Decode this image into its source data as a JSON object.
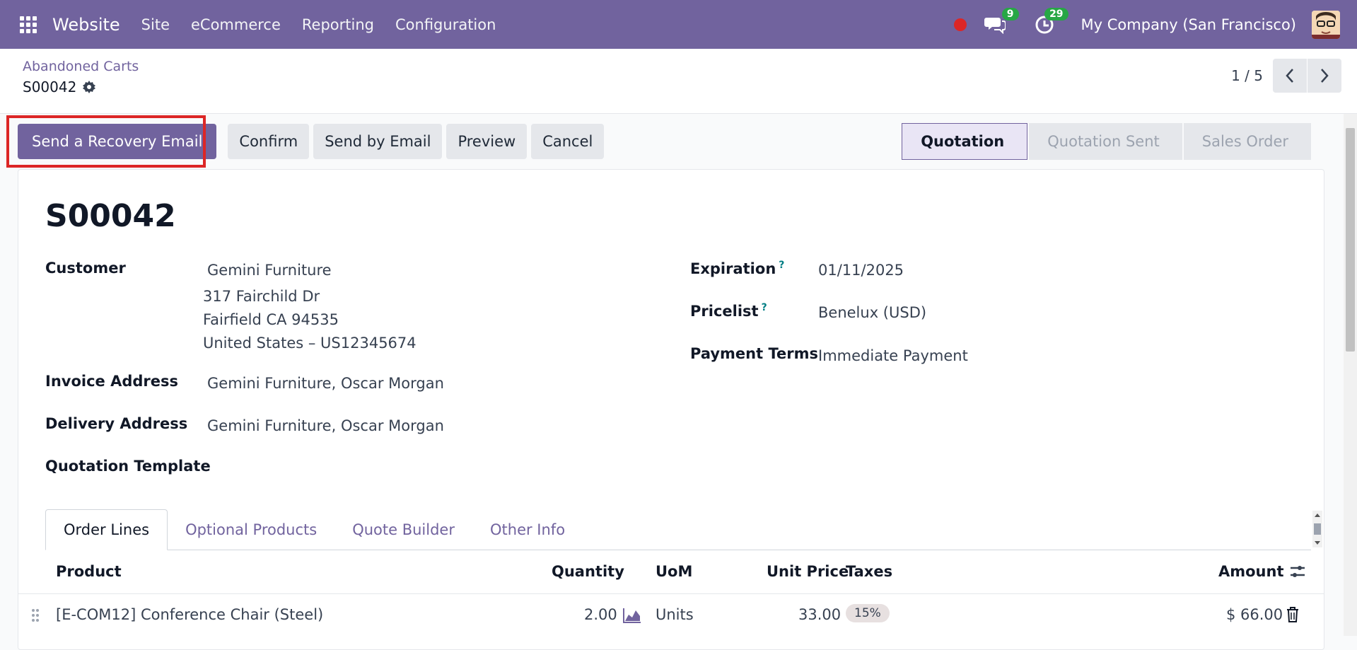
{
  "topbar": {
    "brand": "Website",
    "menus": [
      "Site",
      "eCommerce",
      "Reporting",
      "Configuration"
    ],
    "messages_count": "9",
    "activities_count": "29",
    "company": "My Company (San Francisco)"
  },
  "control_panel": {
    "breadcrumb_parent": "Abandoned Carts",
    "record_name": "S00042",
    "pager_value": "1 / 5"
  },
  "actions": {
    "recovery_email": "Send a Recovery Email",
    "confirm": "Confirm",
    "send_by_email": "Send by Email",
    "preview": "Preview",
    "cancel": "Cancel"
  },
  "status": {
    "steps": [
      "Quotation",
      "Quotation Sent",
      "Sales Order"
    ],
    "active": "Quotation"
  },
  "form": {
    "title": "S00042",
    "customer_label": "Customer",
    "customer_name": "Gemini Furniture",
    "customer_addr1": "317 Fairchild Dr",
    "customer_addr2": "Fairfield CA 94535",
    "customer_addr3": "United States – US12345674",
    "invoice_label": "Invoice Address",
    "invoice_value": "Gemini Furniture, Oscar Morgan",
    "delivery_label": "Delivery Address",
    "delivery_value": "Gemini Furniture, Oscar Morgan",
    "template_label": "Quotation Template",
    "expiration_label": "Expiration",
    "expiration_value": "01/11/2025",
    "pricelist_label": "Pricelist",
    "pricelist_value": "Benelux (USD)",
    "payment_terms_label": "Payment Terms",
    "payment_terms_value": "Immediate Payment",
    "help_mark": "?"
  },
  "tabs": [
    "Order Lines",
    "Optional Products",
    "Quote Builder",
    "Other Info"
  ],
  "table": {
    "headers": {
      "product": "Product",
      "quantity": "Quantity",
      "uom": "UoM",
      "unit_price": "Unit Price",
      "taxes": "Taxes",
      "amount": "Amount"
    },
    "rows": [
      {
        "product": "[E-COM12] Conference Chair (Steel)",
        "quantity": "2.00",
        "uom": "Units",
        "unit_price": "33.00",
        "taxes": "15%",
        "amount": "$ 66.00"
      }
    ]
  },
  "colors": {
    "brand": "#71639e",
    "highlight": "#dc2626",
    "badge": "#27a745"
  }
}
